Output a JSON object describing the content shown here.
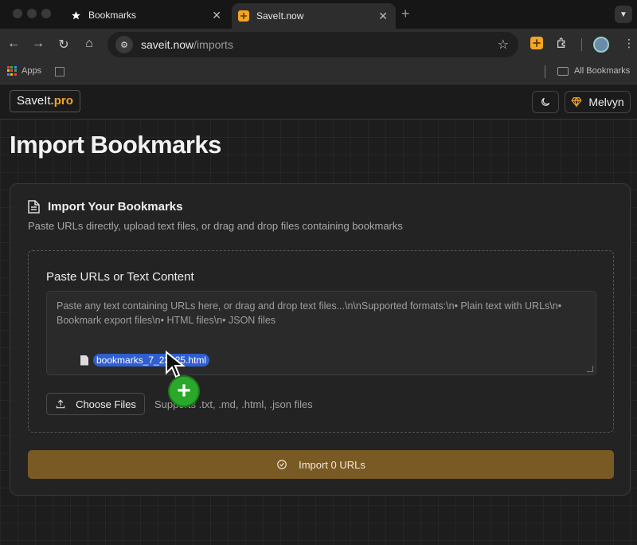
{
  "browser": {
    "tabs": [
      {
        "title": "Bookmarks",
        "active": false
      },
      {
        "title": "SaveIt.now",
        "active": true
      }
    ],
    "url": {
      "host": "saveit.now",
      "path": "/imports"
    },
    "bookmarks_bar": {
      "apps_label": "Apps",
      "all_label": "All Bookmarks"
    }
  },
  "header": {
    "logo_main": "SaveIt",
    "logo_suffix": ".pro",
    "user_name": "Melvyn"
  },
  "page": {
    "title": "Import Bookmarks"
  },
  "card": {
    "heading": "Import Your Bookmarks",
    "description": "Paste URLs directly, upload text files, or drag and drop files containing bookmarks",
    "dropzone_label": "Paste URLs or Text Content",
    "textarea_placeholder": "Paste any text containing URLs here, or drag and drop text files...\\n\\nSupported formats:\\n• Plain text with URLs\\n• Bookmark export files\\n• HTML files\\n• JSON files",
    "dragged_file": "bookmarks_7_23_25.html",
    "choose_files_label": "Choose Files",
    "supports_text": "Supports .txt, .md, .html, .json files",
    "import_button_label": "Import 0 URLs"
  },
  "colors": {
    "accent": "#f5a524",
    "import_button": "#7a5a24",
    "drag_highlight": "#2f5fd0",
    "drop_plus": "#2aa82a"
  }
}
